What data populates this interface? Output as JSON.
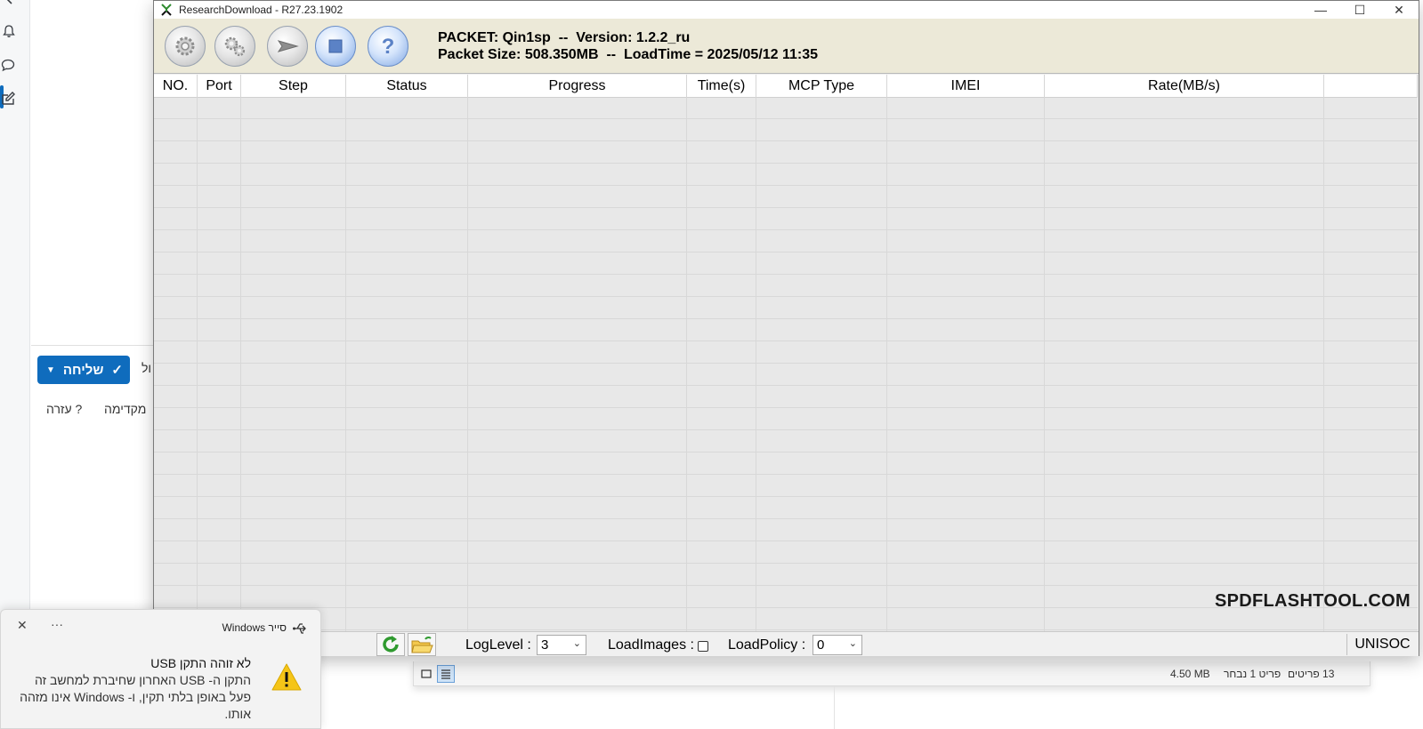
{
  "window": {
    "title": "ResearchDownload - R27.23.1902",
    "minimize_glyph": "—",
    "maximize_glyph": "☐",
    "close_glyph": "✕"
  },
  "toolbar": {
    "buttons": [
      {
        "icon": "gear-icon",
        "style": "grey"
      },
      {
        "icon": "gears-icon",
        "style": "grey"
      },
      {
        "icon": "play-icon",
        "style": "grey"
      },
      {
        "icon": "stop-icon",
        "style": "blue"
      },
      {
        "icon": "help-icon",
        "style": "blue"
      }
    ],
    "packet_line1": "PACKET: Qin1sp  --  Version: 1.2.2_ru",
    "packet_line2": "Packet Size: 508.350MB  --  LoadTime = 2025/05/12 11:35"
  },
  "grid": {
    "columns": [
      "NO.",
      "Port",
      "Step",
      "Status",
      "Progress",
      "Time(s)",
      "MCP Type",
      "IMEI",
      "Rate(MB/s)",
      ""
    ],
    "rows": []
  },
  "watermark": "SPDFLASHTOOL.COM",
  "statusbar": {
    "log_level_label": "LogLevel :",
    "log_level_value": "3",
    "load_images_label": "LoadImages :",
    "load_images_checked": false,
    "load_policy_label": "LoadPolicy :",
    "load_policy_value": "0",
    "vendor": "UNISOC"
  },
  "background_app": {
    "send_label": "שליחה",
    "cut_text": "ול",
    "help_label": "? עזרה",
    "advanced_label": "מקדימה"
  },
  "explorer_status": {
    "items_count": "13 פריטים",
    "selected": "פריט 1 נבחר",
    "size": "4.50 MB"
  },
  "toast": {
    "app_name": "סייר Windows",
    "more_glyph": "···",
    "close_glyph": "✕",
    "title": "לא זוהה התקן USB",
    "body": "התקן ה- USB האחרון שחיברת למחשב זה פעל באופן בלתי תקין, ו- Windows אינו מזהה אותו.",
    "warning_color": "#f5c518"
  },
  "colors": {
    "accent": "#0f6cbd",
    "toolbar_bg": "#ece9d8",
    "grid_bg": "#e8e8e8"
  }
}
